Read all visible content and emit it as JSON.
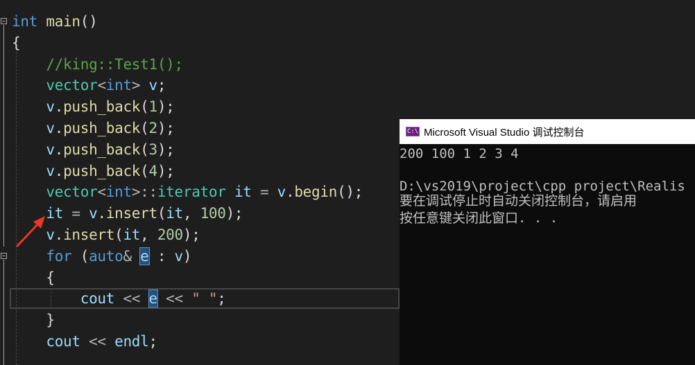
{
  "editor": {
    "lines": [
      [
        {
          "t": "int",
          "c": "kw"
        },
        {
          "t": " ",
          "c": "pl"
        },
        {
          "t": "main",
          "c": "fn"
        },
        {
          "t": "()",
          "c": "pl"
        }
      ],
      [
        {
          "t": "{",
          "c": "pl"
        }
      ],
      [
        {
          "t": "    ",
          "c": "pl"
        },
        {
          "t": "//king::Test1();",
          "c": "cm"
        }
      ],
      [
        {
          "t": "    ",
          "c": "pl"
        },
        {
          "t": "vector",
          "c": "ty"
        },
        {
          "t": "<",
          "c": "op"
        },
        {
          "t": "int",
          "c": "kw"
        },
        {
          "t": ">",
          "c": "op"
        },
        {
          "t": " ",
          "c": "pl"
        },
        {
          "t": "v",
          "c": "id"
        },
        {
          "t": ";",
          "c": "pl"
        }
      ],
      [
        {
          "t": "    ",
          "c": "pl"
        },
        {
          "t": "v",
          "c": "id"
        },
        {
          "t": ".",
          "c": "pl"
        },
        {
          "t": "push_back",
          "c": "fn"
        },
        {
          "t": "(",
          "c": "pl"
        },
        {
          "t": "1",
          "c": "nm"
        },
        {
          "t": ");",
          "c": "pl"
        }
      ],
      [
        {
          "t": "    ",
          "c": "pl"
        },
        {
          "t": "v",
          "c": "id"
        },
        {
          "t": ".",
          "c": "pl"
        },
        {
          "t": "push_back",
          "c": "fn"
        },
        {
          "t": "(",
          "c": "pl"
        },
        {
          "t": "2",
          "c": "nm"
        },
        {
          "t": ");",
          "c": "pl"
        }
      ],
      [
        {
          "t": "    ",
          "c": "pl"
        },
        {
          "t": "v",
          "c": "id"
        },
        {
          "t": ".",
          "c": "pl"
        },
        {
          "t": "push_back",
          "c": "fn"
        },
        {
          "t": "(",
          "c": "pl"
        },
        {
          "t": "3",
          "c": "nm"
        },
        {
          "t": ");",
          "c": "pl"
        }
      ],
      [
        {
          "t": "    ",
          "c": "pl"
        },
        {
          "t": "v",
          "c": "id"
        },
        {
          "t": ".",
          "c": "pl"
        },
        {
          "t": "push_back",
          "c": "fn"
        },
        {
          "t": "(",
          "c": "pl"
        },
        {
          "t": "4",
          "c": "nm"
        },
        {
          "t": ");",
          "c": "pl"
        }
      ],
      [
        {
          "t": "    ",
          "c": "pl"
        },
        {
          "t": "vector",
          "c": "ty"
        },
        {
          "t": "<",
          "c": "op"
        },
        {
          "t": "int",
          "c": "kw"
        },
        {
          "t": ">::",
          "c": "op"
        },
        {
          "t": "iterator",
          "c": "ty"
        },
        {
          "t": " ",
          "c": "pl"
        },
        {
          "t": "it",
          "c": "id"
        },
        {
          "t": " = ",
          "c": "op"
        },
        {
          "t": "v",
          "c": "id"
        },
        {
          "t": ".",
          "c": "pl"
        },
        {
          "t": "begin",
          "c": "fn"
        },
        {
          "t": "();",
          "c": "pl"
        }
      ],
      [
        {
          "t": "    ",
          "c": "pl"
        },
        {
          "t": "it",
          "c": "id"
        },
        {
          "t": " = ",
          "c": "op"
        },
        {
          "t": "v",
          "c": "id"
        },
        {
          "t": ".",
          "c": "pl"
        },
        {
          "t": "insert",
          "c": "fn"
        },
        {
          "t": "(",
          "c": "pl"
        },
        {
          "t": "it",
          "c": "id"
        },
        {
          "t": ", ",
          "c": "pl"
        },
        {
          "t": "100",
          "c": "nm"
        },
        {
          "t": ");",
          "c": "pl"
        }
      ],
      [
        {
          "t": "    ",
          "c": "pl"
        },
        {
          "t": "v",
          "c": "id"
        },
        {
          "t": ".",
          "c": "pl"
        },
        {
          "t": "insert",
          "c": "fn"
        },
        {
          "t": "(",
          "c": "pl"
        },
        {
          "t": "it",
          "c": "id"
        },
        {
          "t": ", ",
          "c": "pl"
        },
        {
          "t": "200",
          "c": "nm"
        },
        {
          "t": ");",
          "c": "pl"
        }
      ],
      [
        {
          "t": "    ",
          "c": "pl"
        },
        {
          "t": "for",
          "c": "kw"
        },
        {
          "t": " (",
          "c": "pl"
        },
        {
          "t": "auto",
          "c": "kw"
        },
        {
          "t": "& ",
          "c": "op"
        },
        {
          "t": "e",
          "c": "id",
          "hl": true
        },
        {
          "t": " : ",
          "c": "pl"
        },
        {
          "t": "v",
          "c": "id"
        },
        {
          "t": ")",
          "c": "pl"
        }
      ],
      [
        {
          "t": "    ",
          "c": "pl"
        },
        {
          "t": "{",
          "c": "pl"
        }
      ],
      [
        {
          "t": "        ",
          "c": "pl"
        },
        {
          "t": "cout",
          "c": "id"
        },
        {
          "t": " << ",
          "c": "op"
        },
        {
          "t": "e",
          "c": "id",
          "hl": true
        },
        {
          "t": " << ",
          "c": "op"
        },
        {
          "t": "\" \"",
          "c": "st"
        },
        {
          "t": ";",
          "c": "pl"
        }
      ],
      [
        {
          "t": "    ",
          "c": "pl"
        },
        {
          "t": "}",
          "c": "pl"
        }
      ],
      [
        {
          "t": "    ",
          "c": "pl"
        },
        {
          "t": "cout",
          "c": "id"
        },
        {
          "t": " << ",
          "c": "op"
        },
        {
          "t": "endl",
          "c": "id"
        },
        {
          "t": ";",
          "c": "pl"
        }
      ]
    ]
  },
  "console": {
    "icon_text": "C:\\",
    "title": "Microsoft Visual Studio 调试控制台",
    "lines": [
      "200 100 1 2 3 4",
      "",
      "D:\\vs2019\\project\\cpp project\\Realis",
      "要在调试停止时自动关闭控制台，请启用",
      "按任意键关闭此窗口. . ."
    ]
  },
  "colors": {
    "editor_bg": "#1e1e1e",
    "keyword": "#569cd6",
    "type": "#4ec9b0",
    "function": "#dcdcaa",
    "comment": "#57a64a",
    "number": "#b5cea8",
    "string": "#d69d85",
    "identifier": "#9cdcfe",
    "annotation_arrow": "#e8382b",
    "console_bg": "#0c0c0c"
  }
}
